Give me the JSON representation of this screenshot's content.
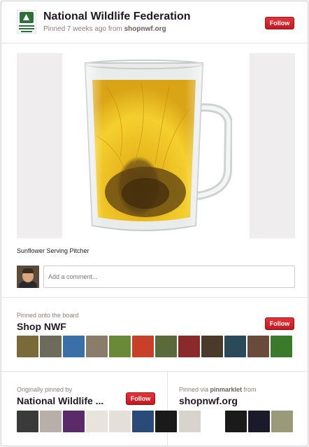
{
  "header": {
    "owner": "National Wildlife Federation",
    "pinned_prefix": "Pinned 7 weeks ago from ",
    "source": "shopnwf.org",
    "follow_label": "Follow"
  },
  "pin": {
    "caption": "Sunflower Serving Pitcher",
    "comment_placeholder": "Add a comment..."
  },
  "board": {
    "label": "Pinned onto the board",
    "name": "Shop NWF",
    "follow_label": "Follow",
    "thumb_colors": [
      "#7a6a3a",
      "#6e6a5c",
      "#3b6fa8",
      "#8a7c6a",
      "#6a8a3a",
      "#c8402a",
      "#5a6a3a",
      "#8a2a2a",
      "#4a3a2a",
      "#2a4a5a",
      "#6a4a3a",
      "#3a7a2a"
    ]
  },
  "origin": {
    "label": "Originally pinned by",
    "name": "National Wildlife ...",
    "follow_label": "Follow",
    "thumb_colors": [
      "#3a3a3a",
      "#b8b0a8",
      "#5a2a6a",
      "#e8e4dc",
      "#e4e0d8",
      "#2a4a7a",
      "#1a1a1a"
    ]
  },
  "via": {
    "prefix": "Pinned via ",
    "tool": "pinmarklet",
    "suffix": " from",
    "site": "shopnwf.org",
    "thumb_colors": [
      "#d8d4cc",
      "#ffffff",
      "#1a1a1a",
      "#1a1a2a",
      "#9a9a7a"
    ]
  }
}
